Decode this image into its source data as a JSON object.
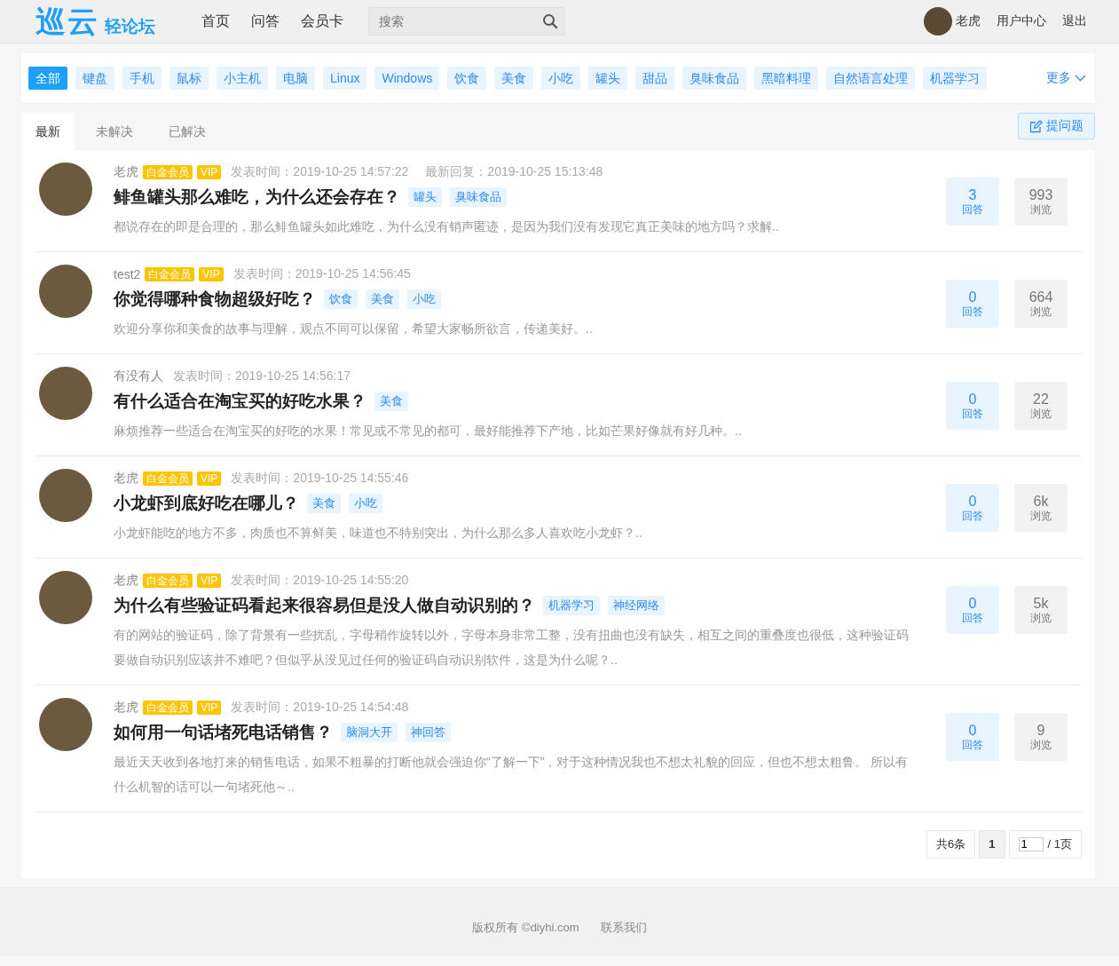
{
  "header": {
    "logo": {
      "mark": "巡云",
      "sub": "轻论坛"
    },
    "nav": [
      "首页",
      "问答",
      "会员卡"
    ],
    "search": {
      "placeholder": "搜索"
    },
    "user": {
      "name": "老虎"
    },
    "links": [
      "用户中心",
      "退出"
    ]
  },
  "categories": {
    "items": [
      {
        "label": "全部",
        "selected": true
      },
      {
        "label": "键盘",
        "selected": false
      },
      {
        "label": "手机",
        "selected": false
      },
      {
        "label": "鼠标",
        "selected": false
      },
      {
        "label": "小主机",
        "selected": false
      },
      {
        "label": "电脑",
        "selected": false
      },
      {
        "label": "Linux",
        "selected": false
      },
      {
        "label": "Windows",
        "selected": false
      },
      {
        "label": "饮食",
        "selected": false
      },
      {
        "label": "美食",
        "selected": false
      },
      {
        "label": "小吃",
        "selected": false
      },
      {
        "label": "罐头",
        "selected": false
      },
      {
        "label": "甜品",
        "selected": false
      },
      {
        "label": "臭味食品",
        "selected": false
      },
      {
        "label": "黑暗料理",
        "selected": false
      },
      {
        "label": "自然语言处理",
        "selected": false
      },
      {
        "label": "机器学习",
        "selected": false
      }
    ],
    "more": "更多"
  },
  "tabs": [
    {
      "label": "最新",
      "selected": true
    },
    {
      "label": "未解决",
      "selected": false
    },
    {
      "label": "已解决",
      "selected": false
    }
  ],
  "ask_button": "提问题",
  "questions": [
    {
      "author": "老虎",
      "badges": [
        "白金会员",
        "VIP"
      ],
      "posted": "发表时间：2019-10-25 14:57:22",
      "last_reply": "最新回复：2019-10-25 15:13:48",
      "title": "鲱鱼罐头那么难吃，为什么还会存在？",
      "tags": [
        "罐头",
        "臭味食品"
      ],
      "excerpt": "都说存在的即是合理的，那么鲱鱼罐头如此难吃，为什么没有销声匿迹，是因为我们没有发现它真正美味的地方吗？求解..",
      "answers": {
        "count": "3",
        "label": "回答"
      },
      "views": {
        "count": "993",
        "label": "浏览"
      }
    },
    {
      "author": "test2",
      "badges": [
        "白金会员",
        "VIP"
      ],
      "posted": "发表时间：2019-10-25 14:56:45",
      "title": "你觉得哪种食物超级好吃？",
      "tags": [
        "饮食",
        "美食",
        "小吃"
      ],
      "excerpt": "欢迎分享你和美食的故事与理解，观点不同可以保留，希望大家畅所欲言，传递美好。..",
      "answers": {
        "count": "0",
        "label": "回答"
      },
      "views": {
        "count": "664",
        "label": "浏览"
      }
    },
    {
      "author": "有没有人",
      "posted": "发表时间：2019-10-25 14:56:17",
      "title": "有什么适合在淘宝买的好吃水果？",
      "tags": [
        "美食"
      ],
      "excerpt": "麻烦推荐一些适合在淘宝买的好吃的水果！常见或不常见的都可，最好能推荐下产地，比如芒果好像就有好几种。..",
      "answers": {
        "count": "0",
        "label": "回答"
      },
      "views": {
        "count": "22",
        "label": "浏览"
      }
    },
    {
      "author": "老虎",
      "badges": [
        "白金会员",
        "VIP"
      ],
      "posted": "发表时间：2019-10-25 14:55:46",
      "title": "小龙虾到底好吃在哪儿？",
      "tags": [
        "美食",
        "小吃"
      ],
      "excerpt": "小龙虾能吃的地方不多，肉质也不算鲜美，味道也不特别突出，为什么那么多人喜欢吃小龙虾？..",
      "answers": {
        "count": "0",
        "label": "回答"
      },
      "views": {
        "count": "6k",
        "label": "浏览"
      }
    },
    {
      "author": "老虎",
      "badges": [
        "白金会员",
        "VIP"
      ],
      "posted": "发表时间：2019-10-25 14:55:20",
      "title": "为什么有些验证码看起来很容易但是没人做自动识别的？",
      "tags": [
        "机器学习",
        "神经网络"
      ],
      "excerpt": "有的网站的验证码，除了背景有一些扰乱，字母稍作旋转以外，字母本身非常工整，没有扭曲也没有缺失，相互之间的重叠度也很低，这种验证码要做自动识别应该并不难吧？但似乎从没见过任何的验证码自动识别软件，这是为什么呢？..",
      "answers": {
        "count": "0",
        "label": "回答"
      },
      "views": {
        "count": "5k",
        "label": "浏览"
      }
    },
    {
      "author": "老虎",
      "badges": [
        "白金会员",
        "VIP"
      ],
      "posted": "发表时间：2019-10-25 14:54:48",
      "title": "如何用一句话堵死电话销售？",
      "tags": [
        "脑洞大开",
        "神回答"
      ],
      "excerpt": "最近天天收到各地打来的销售电话，如果不粗暴的打断他就会强迫你“了解一下”，对于这种情况我也不想太礼貌的回应，但也不想太粗鲁。 所以有什么机智的话可以一句堵死他～..",
      "answers": {
        "count": "0",
        "label": "回答"
      },
      "views": {
        "count": "9",
        "label": "浏览"
      }
    }
  ],
  "pagination": {
    "total": "共6条",
    "current": "1",
    "page_input": "1",
    "pages": "/ 1页"
  },
  "footer": [
    "版权所有 ©diyhi.com",
    "联系我们"
  ]
}
